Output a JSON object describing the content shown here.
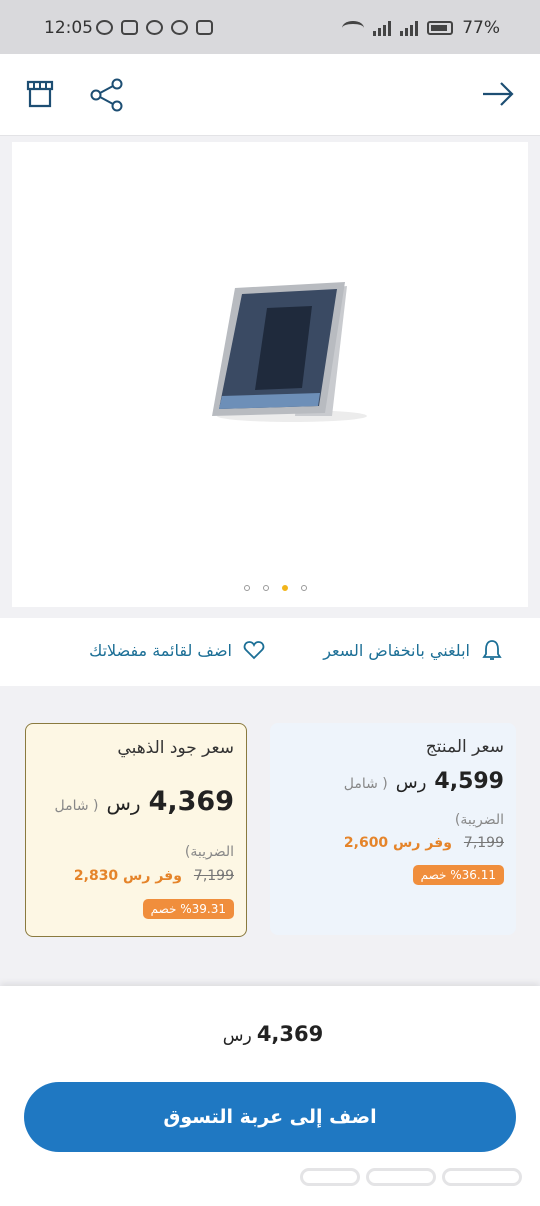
{
  "status_bar": {
    "time": "12:05",
    "battery": "77%"
  },
  "top_bar": {
    "icons": [
      "store-icon",
      "share-icon",
      "arrow-right-icon"
    ]
  },
  "gallery": {
    "image": "surface-tablet-image",
    "dots_count": 4,
    "active_dot": 3
  },
  "actions": {
    "notify_label": "ابلغني بانخفاض السعر",
    "favorite_label": "اضف لقائمة مفضلاتك"
  },
  "product_price": {
    "title": "سعر المنتج",
    "price": "4,599",
    "currency": "رس",
    "tax_note_open": "( شامل",
    "tax_note_close": "الضريبة)",
    "old_price": "7,199",
    "save_text": "وفر رس 2,600",
    "discount_badge": "%36.11 خصم"
  },
  "gold_price": {
    "title": "سعر جود الذهبي",
    "price": "4,369",
    "currency": "رس",
    "tax_note_open": "( شامل",
    "tax_note_close": "الضريبة)",
    "old_price": "7,199",
    "save_text": "وفر رس 2,830",
    "discount_badge": "%39.31 خصم"
  },
  "bottom": {
    "total_price": "4,369",
    "total_currency": "رس",
    "cart_button": "اضف إلى عربة التسوق"
  },
  "colors": {
    "accent": "#1f78c2",
    "link": "#1c6f96",
    "save": "#e5842a",
    "badge": "#f08e3c",
    "gold_border": "#8a7a3e"
  }
}
